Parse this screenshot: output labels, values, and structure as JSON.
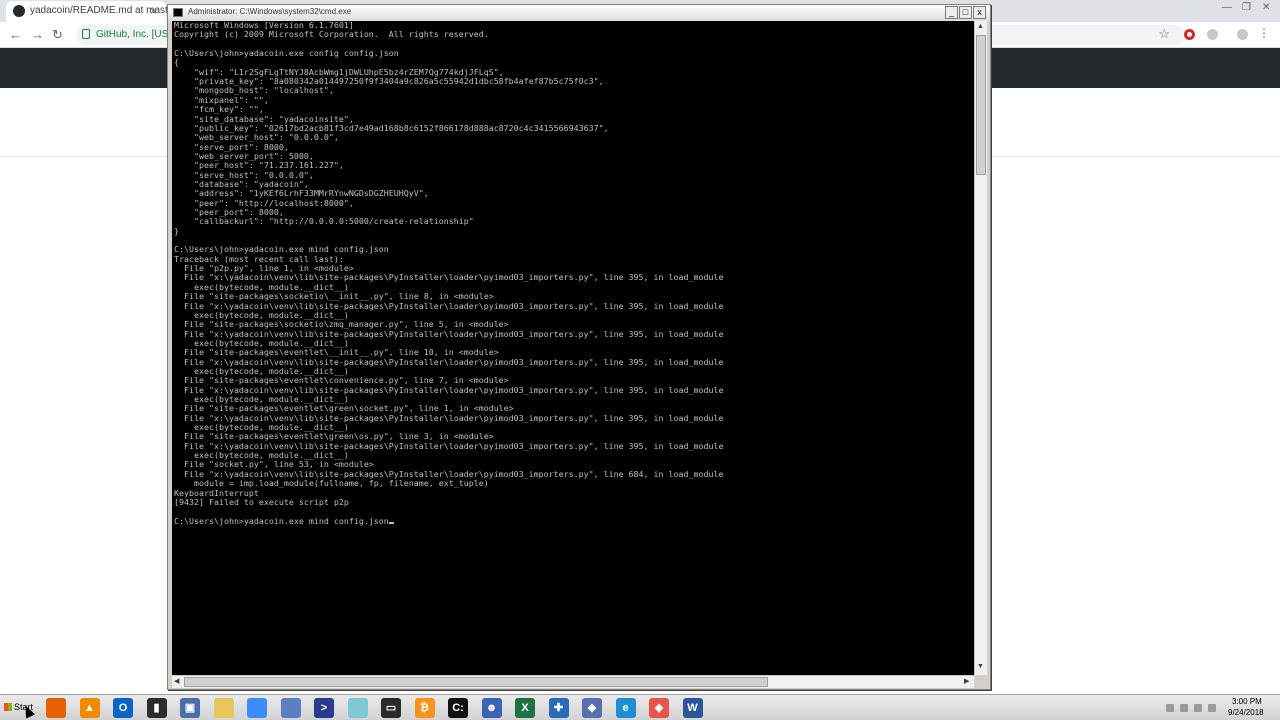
{
  "chrome": {
    "tab_title": "yadacoin/README.md at master",
    "tab_close": "×",
    "site_identity": "GitHub, Inc. [US]",
    "back_glyph": "←",
    "forward_glyph": "→",
    "reload_glyph": "↻",
    "star_glyph": "☆",
    "menu_glyph": "⋮",
    "min_glyph": "—",
    "max_glyph": "❐",
    "close_glyph": "✕"
  },
  "cmd": {
    "title": "Administrator: C:\\Windows\\system32\\cmd.exe",
    "btn_min": "_",
    "btn_max": "□",
    "btn_close": "x",
    "lines": [
      "Microsoft Windows [Version 6.1.7601]",
      "Copyright (c) 2009 Microsoft Corporation.  All rights reserved.",
      "",
      "C:\\Users\\john>yadacoin.exe config config.json",
      "{",
      "    \"wif\": \"L1r2SgFLgTtNYJ8AcbWmg1jDWLUhpE5bz4rZEM7Qg774kdjJFLqS\",",
      "    \"private_key\": \"8a080342a014497250f9f3404a9c826a5c55942d1dbc58fb4afef87b5c75f0c3\",",
      "    \"mongodb_host\": \"localhost\",",
      "    \"mixpanel\": \"\",",
      "    \"fcm_key\": \"\",",
      "    \"site_database\": \"yadacoinsite\",",
      "    \"public_key\": \"02617bd2acb81f3cd7e49ad168b8c6152f866178d888ac8720c4c3415566943637\",",
      "    \"web_server_host\": \"0.0.0.0\",",
      "    \"serve_port\": 8000,",
      "    \"web_server_port\": 5000,",
      "    \"peer_host\": \"71.237.161.227\",",
      "    \"serve_host\": \"0.0.0.0\",",
      "    \"database\": \"yadacoin\",",
      "    \"address\": \"1yKEf6LrhF33MMrRYnwNGDsDGZHEUHQyV\",",
      "    \"peer\": \"http://localhost:8000\",",
      "    \"peer_port\": 8000,",
      "    \"callbackurl\": \"http://0.0.0.0:5000/create-relationship\"",
      "}",
      "",
      "C:\\Users\\john>yadacoin.exe mind config.json",
      "Traceback (most recent call last):",
      "  File \"p2p.py\", line 1, in <module>",
      "  File \"x:\\yadacoin\\venv\\lib\\site-packages\\PyInstaller\\loader\\pyimod03_importers.py\", line 395, in load_module",
      "    exec(bytecode, module.__dict__)",
      "  File \"site-packages\\socketio\\__init__.py\", line 8, in <module>",
      "  File \"x:\\yadacoin\\venv\\lib\\site-packages\\PyInstaller\\loader\\pyimod03_importers.py\", line 395, in load_module",
      "    exec(bytecode, module.__dict__)",
      "  File \"site-packages\\socketio\\zmq_manager.py\", line 5, in <module>",
      "  File \"x:\\yadacoin\\venv\\lib\\site-packages\\PyInstaller\\loader\\pyimod03_importers.py\", line 395, in load_module",
      "    exec(bytecode, module.__dict__)",
      "  File \"site-packages\\eventlet\\__init__.py\", line 10, in <module>",
      "  File \"x:\\yadacoin\\venv\\lib\\site-packages\\PyInstaller\\loader\\pyimod03_importers.py\", line 395, in load_module",
      "    exec(bytecode, module.__dict__)",
      "  File \"site-packages\\eventlet\\convenience.py\", line 7, in <module>",
      "  File \"x:\\yadacoin\\venv\\lib\\site-packages\\PyInstaller\\loader\\pyimod03_importers.py\", line 395, in load_module",
      "    exec(bytecode, module.__dict__)",
      "  File \"site-packages\\eventlet\\green\\socket.py\", line 1, in <module>",
      "  File \"x:\\yadacoin\\venv\\lib\\site-packages\\PyInstaller\\loader\\pyimod03_importers.py\", line 395, in load_module",
      "    exec(bytecode, module.__dict__)",
      "  File \"site-packages\\eventlet\\green\\os.py\", line 3, in <module>",
      "  File \"x:\\yadacoin\\venv\\lib\\site-packages\\PyInstaller\\loader\\pyimod03_importers.py\", line 395, in load_module",
      "    exec(bytecode, module.__dict__)",
      "  File \"socket.py\", line 53, in <module>",
      "  File \"x:\\yadacoin\\venv\\lib\\site-packages\\PyInstaller\\loader\\pyimod03_importers.py\", line 684, in load_module",
      "    module = imp.load_module(fullname, fp, filename, ext_tuple)",
      "KeyboardInterrupt",
      "[9432] Failed to execute script p2p",
      "",
      "C:\\Users\\john>yadacoin.exe mind config.json"
    ]
  },
  "taskbar": {
    "start_label": "Start",
    "clock_time": "3:00 PM",
    "clock_date": "9/24/2018",
    "apps": [
      {
        "name": "firefox-icon",
        "glyph": "",
        "color": "#e66000"
      },
      {
        "name": "vlc-icon",
        "glyph": "▲",
        "color": "#f08a00"
      },
      {
        "name": "outlook-icon",
        "glyph": "O",
        "color": "#0a64c8"
      },
      {
        "name": "terminal-icon",
        "glyph": "▮",
        "color": "#2c2c2c"
      },
      {
        "name": "network-icon",
        "glyph": "▣",
        "color": "#4a6fa5"
      },
      {
        "name": "folder-icon",
        "glyph": "",
        "color": "#e8c65a"
      },
      {
        "name": "chrome-icon",
        "glyph": "",
        "color": "#3d8bfd"
      },
      {
        "name": "database-icon",
        "glyph": "",
        "color": "#5b7fc0"
      },
      {
        "name": "powershell-icon",
        "glyph": ">",
        "color": "#2a3a8c"
      },
      {
        "name": "notepad-icon",
        "glyph": "",
        "color": "#7fc8d6"
      },
      {
        "name": "remote-desktop-icon",
        "glyph": "▭",
        "color": "#2a2a2a"
      },
      {
        "name": "bitcoin-icon",
        "glyph": "₿",
        "color": "#f7931a"
      },
      {
        "name": "cmd-icon",
        "glyph": "C:",
        "color": "#111111"
      },
      {
        "name": "user-manager-icon",
        "glyph": "☻",
        "color": "#3a64b8"
      },
      {
        "name": "excel-icon",
        "glyph": "X",
        "color": "#1f7244"
      },
      {
        "name": "puzzle-icon",
        "glyph": "✚",
        "color": "#2a6ab8"
      },
      {
        "name": "ethereum-icon",
        "glyph": "◆",
        "color": "#5a6fb0"
      },
      {
        "name": "ie-icon",
        "glyph": "e",
        "color": "#1e8fd6"
      },
      {
        "name": "git-icon",
        "glyph": "◈",
        "color": "#e8564a"
      },
      {
        "name": "word-icon",
        "glyph": "W",
        "color": "#2b579a"
      }
    ]
  }
}
